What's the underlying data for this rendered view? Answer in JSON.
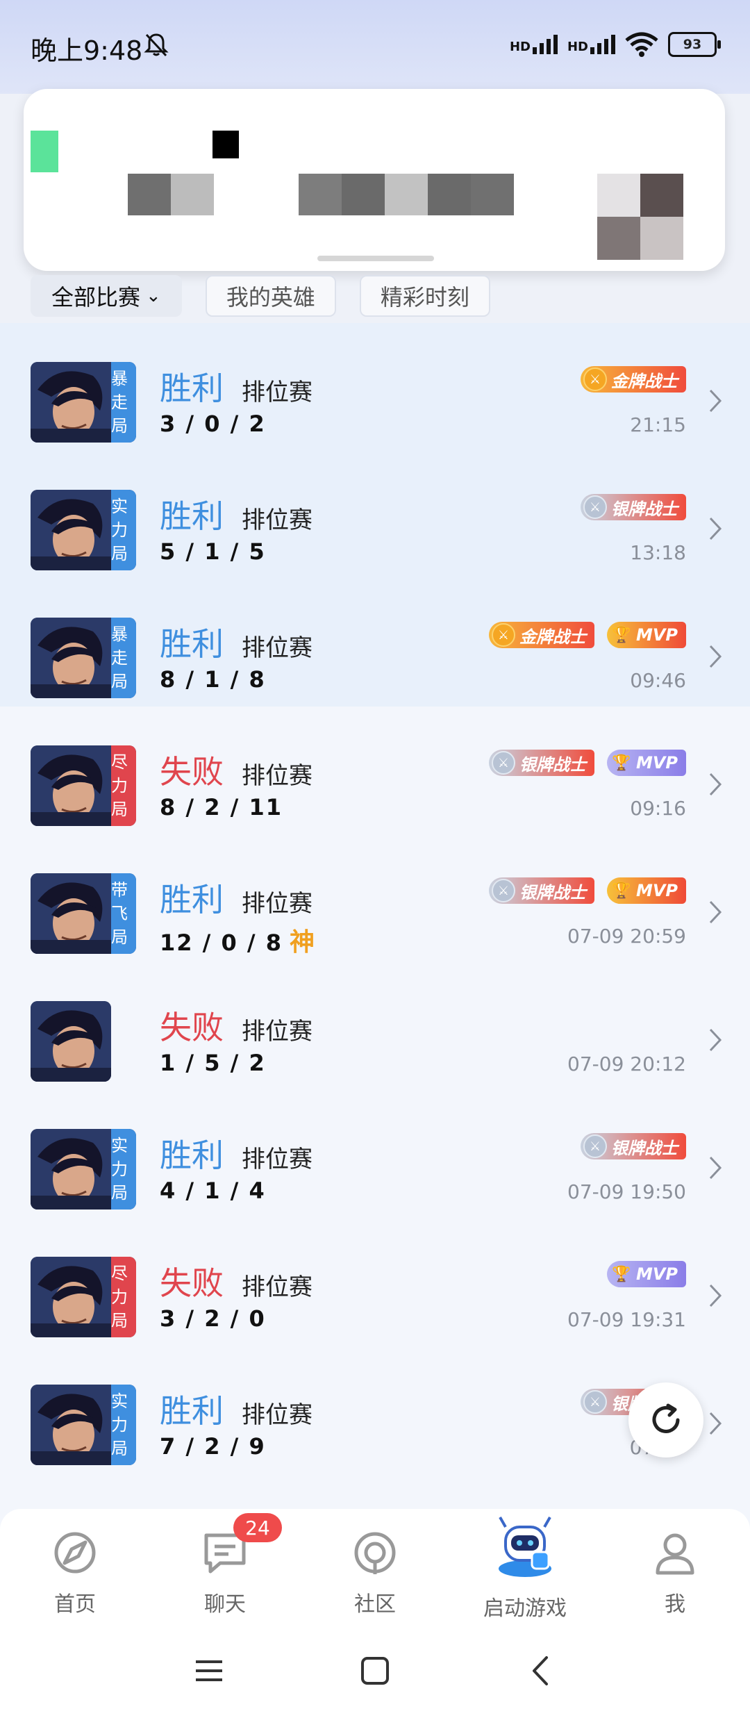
{
  "status": {
    "time": "晚上9:48",
    "signal1": "HD",
    "signal2": "HD",
    "battery": "93"
  },
  "filters": [
    {
      "label": "全部比赛",
      "active": true
    },
    {
      "label": "我的英雄",
      "active": false
    },
    {
      "label": "精彩时刻",
      "active": false
    }
  ],
  "matches": [
    {
      "result": "胜利",
      "mode": "排位赛",
      "kda": "3 / 0 / 2",
      "tag": "暴走局",
      "badges": [
        "金牌战士"
      ],
      "time": "21:15"
    },
    {
      "result": "胜利",
      "mode": "排位赛",
      "kda": "5 / 1 / 5",
      "tag": "实力局",
      "badges": [
        "银牌战士"
      ],
      "time": "13:18"
    },
    {
      "result": "胜利",
      "mode": "排位赛",
      "kda": "8 / 1 / 8",
      "tag": "暴走局",
      "badges": [
        "金牌战士",
        "MVP"
      ],
      "time": "09:46"
    },
    {
      "result": "失败",
      "mode": "排位赛",
      "kda": "8 / 2 / 11",
      "tag": "尽力局",
      "badges": [
        "银牌战士",
        "MVP"
      ],
      "time": "09:16"
    },
    {
      "result": "胜利",
      "mode": "排位赛",
      "kda": "12 / 0 / 8",
      "god": "神",
      "tag": "带飞局",
      "badges": [
        "银牌战士",
        "MVP"
      ],
      "time": "07-09 20:59"
    },
    {
      "result": "失败",
      "mode": "排位赛",
      "kda": "1 / 5 / 2",
      "tag": "",
      "badges": [],
      "time": "07-09 20:12"
    },
    {
      "result": "胜利",
      "mode": "排位赛",
      "kda": "4 / 1 / 4",
      "tag": "实力局",
      "badges": [
        "银牌战士"
      ],
      "time": "07-09 19:50"
    },
    {
      "result": "失败",
      "mode": "排位赛",
      "kda": "3 / 2 / 0",
      "tag": "尽力局",
      "badges": [
        "MVP"
      ],
      "time": "07-09 19:31"
    },
    {
      "result": "胜利",
      "mode": "排位赛",
      "kda": "7 / 2 / 9",
      "tag": "实力局",
      "badges": [
        "银牌战士"
      ],
      "time": "07-09"
    }
  ],
  "tabbar": {
    "home": "首页",
    "chat": "聊天",
    "chat_badge": "24",
    "community": "社区",
    "launch": "启动游戏",
    "me": "我"
  },
  "colors": {
    "win": "#3f8fdf",
    "lose": "#e0454d",
    "accent": "#ef4b4b"
  }
}
